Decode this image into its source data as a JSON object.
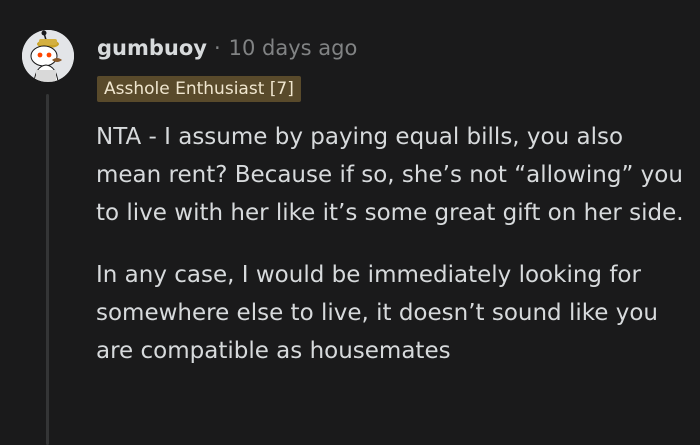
{
  "comment": {
    "author": "gumbuoy",
    "separator": "·",
    "timestamp": "10 days ago",
    "flair": "Asshole Enthusiast [7]",
    "avatar_icon": "snoo-avatar-icon",
    "paragraphs": [
      "NTA - I assume by paying equal bills, you also mean rent? Because if so, she’s not “allowing” you to live with her like it’s some great gift on her side.",
      "In any case, I would be immediately looking for somewhere else to live, it doesn’t sound like you are compatible as housemates"
    ]
  },
  "colors": {
    "background": "#1a1a1b",
    "text": "#d7dadc",
    "meta": "#818384",
    "flair_bg": "#594a2b",
    "thread_line": "#343536"
  }
}
